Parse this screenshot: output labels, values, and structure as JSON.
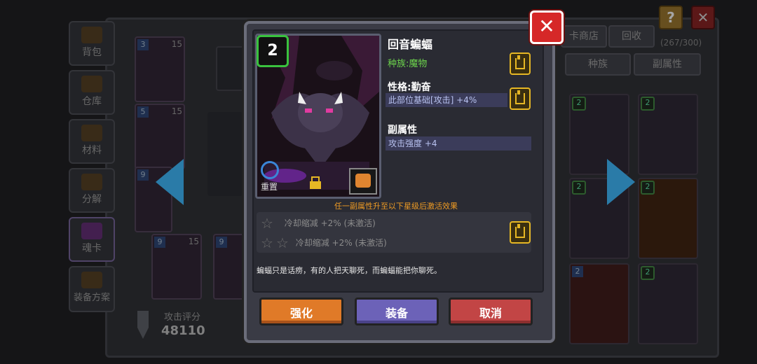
{
  "sidebar": {
    "items": [
      {
        "label": "背包"
      },
      {
        "label": "仓库"
      },
      {
        "label": "材料"
      },
      {
        "label": "分解"
      },
      {
        "label": "魂卡"
      },
      {
        "label": "装备方案"
      }
    ]
  },
  "top_bar": {
    "shop_label": "卡商店",
    "recycle_label": "回收",
    "count": "(267/300)",
    "help_label": "?",
    "filter_race_label": "种族",
    "filter_sub_label": "副属性"
  },
  "score": {
    "label": "攻击评分",
    "value": "48110"
  },
  "background_cards": {
    "left": [
      {
        "level": "3",
        "max": "15"
      },
      {
        "level": "5",
        "max": "15"
      },
      {
        "level": "9",
        "max": ""
      },
      {
        "level": "9",
        "max": "15"
      },
      {
        "level": "9",
        "max": ""
      }
    ],
    "right_badges": [
      "2",
      "2",
      "2",
      "2",
      "2",
      "2"
    ]
  },
  "card_detail": {
    "level": "2",
    "name": "回音蝙蝠",
    "race": "种族:魔物",
    "trait_title": "性格:勤奋",
    "trait_effect": "此部位基础[攻击] +4%",
    "sub_title": "副属性",
    "sub_effect": "攻击强度 +4",
    "reset_label": "重置",
    "activate_hint": "任一副属性升至以下星级后激活效果",
    "star_effects": [
      {
        "text": "冷却缩减 +2% (未激活)",
        "stars": 1
      },
      {
        "text": "冷却缩减 +2% (未激活)",
        "stars": 2
      }
    ],
    "description": "蝙蝠只是话痨，有的人把天聊死，而蝙蝠能把你聊死。"
  },
  "buttons": {
    "upgrade": "强化",
    "equip": "装备",
    "cancel": "取消",
    "close": "✕"
  },
  "colors": {
    "level_badge": "#39c33e",
    "race_text": "#6cd34c",
    "hint_text": "#ee9b24",
    "upgrade": "#e07a28",
    "equip": "#6c62b8",
    "cancel": "#c24545",
    "lock_gold": "#e6b724"
  }
}
